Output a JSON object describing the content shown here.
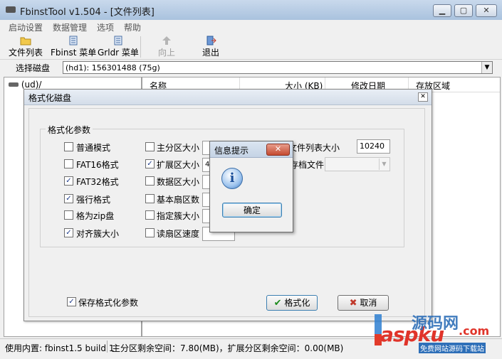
{
  "window": {
    "title": "FbinstTool v1.504 - [文件列表]",
    "controls": {
      "minimize": "▁",
      "maximize": "▢",
      "close": "✕"
    }
  },
  "menu": [
    "启动设置",
    "数据管理",
    "选项",
    "帮助"
  ],
  "toolbar": {
    "file_list": "文件列表",
    "fbinst_menu": "Fbinst 菜单",
    "grldr_menu": "Grldr 菜单",
    "up": "向上",
    "exit": "退出"
  },
  "disk": {
    "label": "选择磁盘",
    "selected": "(hd1): 156301488 (75g)"
  },
  "tree": {
    "root": "(ud)/"
  },
  "list": {
    "columns": [
      "名称",
      "大小 (KB)",
      "修改日期",
      "存放区域"
    ]
  },
  "status": {
    "left": "使用内置: fbinst1.5 build 1",
    "right": "主分区剩余空间：7.80(MB)，扩展分区剩余空间：0.00(MB)"
  },
  "format_dialog": {
    "title": "格式化磁盘",
    "group_label": "格式化参数",
    "col1": [
      {
        "label": "普通模式",
        "checked": false
      },
      {
        "label": "FAT16格式",
        "checked": false
      },
      {
        "label": "FAT32格式",
        "checked": true
      },
      {
        "label": "强行格式",
        "checked": true
      },
      {
        "label": "格为zip盘",
        "checked": false
      },
      {
        "label": "对齐簇大小",
        "checked": true
      }
    ],
    "col2": [
      {
        "label": "主分区大小",
        "checked": false,
        "value": ""
      },
      {
        "label": "扩展区大小",
        "checked": true,
        "value": "40"
      },
      {
        "label": "数据区大小",
        "checked": false,
        "value": ""
      },
      {
        "label": "基本扇区数",
        "checked": false,
        "value": ""
      },
      {
        "label": "指定簇大小",
        "checked": false,
        "value": ""
      },
      {
        "label": "读扇区速度",
        "checked": false,
        "value": ""
      }
    ],
    "file_list_size_label": "文件列表大小",
    "file_list_size_value": "10240",
    "archive_file_label": "存档文件",
    "save_params_label": "保存格式化参数",
    "save_params_checked": true,
    "format_button": "格式化",
    "cancel_button": "取消"
  },
  "message_box": {
    "title": "信息提示",
    "close": "✕",
    "icon": "i",
    "ok_button": "确定"
  },
  "watermark": {
    "brand": "aspku",
    "domain": ".com",
    "chinese": "源码网",
    "tagline": "免费网站源码下载站"
  }
}
